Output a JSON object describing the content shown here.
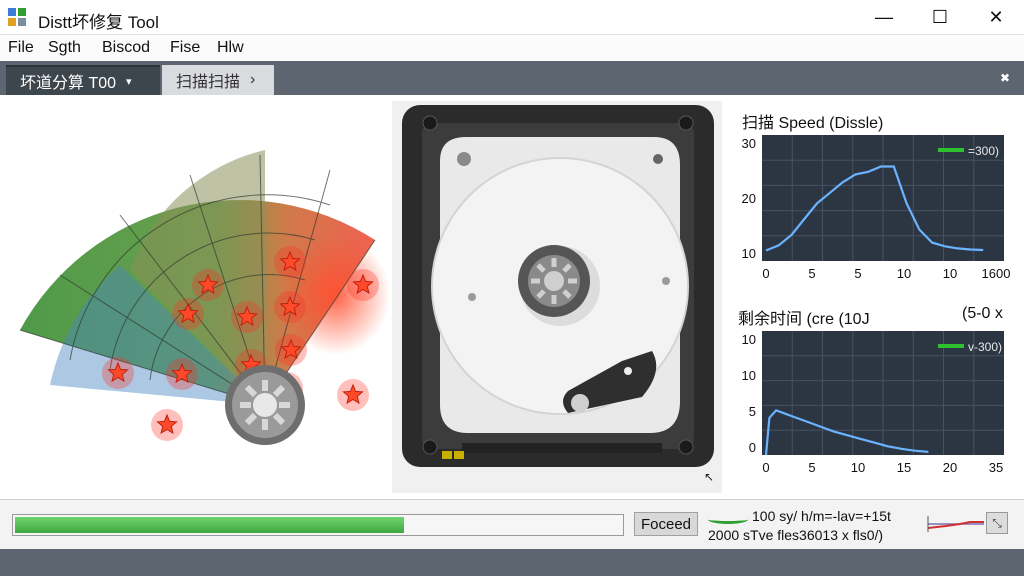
{
  "window": {
    "title": "Distt坏修复 Tool",
    "minimize": "—",
    "maximize": "☐",
    "close": "✕"
  },
  "menu": [
    "File",
    "Sgth",
    "Biscod",
    "Fise",
    "Hlw"
  ],
  "tabs": [
    {
      "label": "坏道分算 T00",
      "arrow": "▾"
    },
    {
      "label": "扫描扫描",
      "arrow": "›"
    }
  ],
  "tab_close": "✖",
  "charts": {
    "speed": {
      "title": "扫描 Speed (Dissle)",
      "legend": "=300)",
      "y_ticks": [
        "30",
        "20",
        "10"
      ],
      "x_ticks": [
        "0",
        "5",
        "5",
        "10",
        "10",
        "1600"
      ],
      "ylim": [
        8,
        32
      ],
      "series": [
        [
          0,
          10
        ],
        [
          1,
          11
        ],
        [
          2,
          13
        ],
        [
          3,
          16
        ],
        [
          4,
          19
        ],
        [
          5,
          21
        ],
        [
          6,
          23
        ],
        [
          7,
          24.5
        ],
        [
          8,
          25
        ],
        [
          9,
          26
        ],
        [
          10,
          26
        ],
        [
          11,
          19
        ],
        [
          12,
          14
        ],
        [
          13,
          11.5
        ],
        [
          14,
          10.8
        ],
        [
          15,
          10.4
        ],
        [
          16,
          10.2
        ],
        [
          17,
          10.1
        ]
      ]
    },
    "remaining": {
      "title": "剩余时间 (cre (10J",
      "right_text": "(5-0 x",
      "legend": "v-300)",
      "y_ticks": [
        "10",
        "10",
        "5",
        "0"
      ],
      "x_ticks": [
        "0",
        "5",
        "10",
        "15",
        "20",
        "35"
      ],
      "ylim": [
        0,
        10
      ],
      "series": [
        [
          0,
          0
        ],
        [
          0.5,
          3
        ],
        [
          1.5,
          3.6
        ],
        [
          2.5,
          3.4
        ],
        [
          4,
          3.1
        ],
        [
          6,
          2.7
        ],
        [
          8,
          2.3
        ],
        [
          10,
          1.9
        ],
        [
          12,
          1.6
        ],
        [
          14,
          1.3
        ],
        [
          16,
          1.0
        ],
        [
          18,
          0.7
        ],
        [
          20,
          0.5
        ],
        [
          22,
          0.35
        ],
        [
          24,
          0.25
        ]
      ]
    }
  },
  "status": {
    "progress": 0.64,
    "proceed_label": "Foceed",
    "stat_line1": "100 sy/ h/m=-lav=+15t",
    "stat_line2": "2000 sTve fles36013 x fls0/)"
  },
  "map_stars": [
    [
      290,
      167
    ],
    [
      208,
      190
    ],
    [
      363,
      190
    ],
    [
      188,
      219
    ],
    [
      290,
      212
    ],
    [
      247,
      222
    ],
    [
      118,
      278
    ],
    [
      182,
      279
    ],
    [
      251,
      270
    ],
    [
      291,
      255
    ],
    [
      256,
      285
    ],
    [
      287,
      293
    ],
    [
      353,
      300
    ],
    [
      167,
      330
    ]
  ]
}
